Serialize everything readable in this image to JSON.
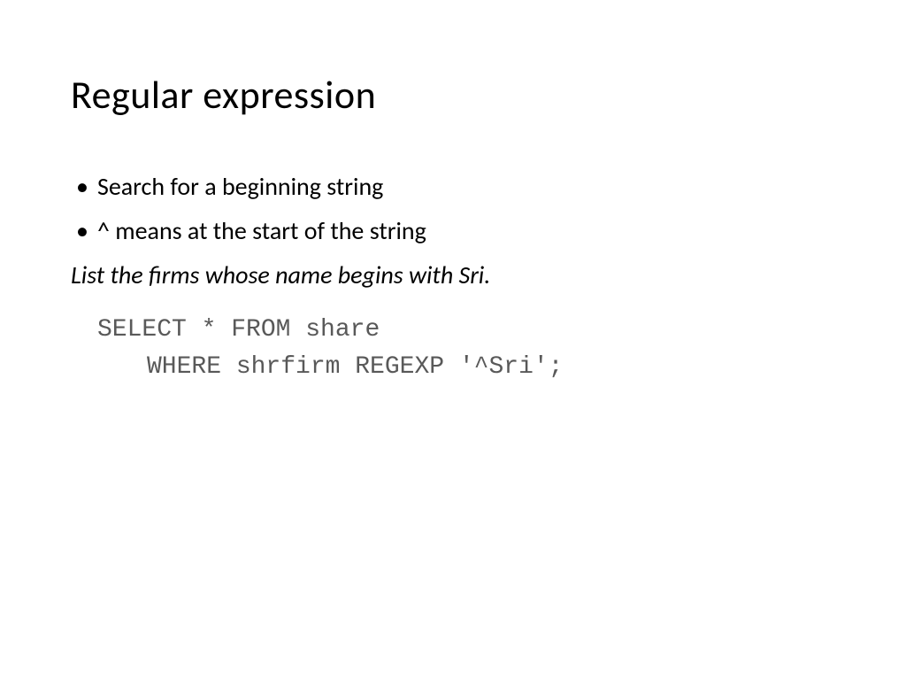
{
  "title": "Regular expression",
  "bullets": [
    "Search for a beginning string",
    "^ means at the start of the string"
  ],
  "italic_text": "List the firms whose name begins with Sri.",
  "code": {
    "line1": "SELECT * FROM share",
    "line2": "WHERE shrfirm REGEXP '^Sri';"
  }
}
